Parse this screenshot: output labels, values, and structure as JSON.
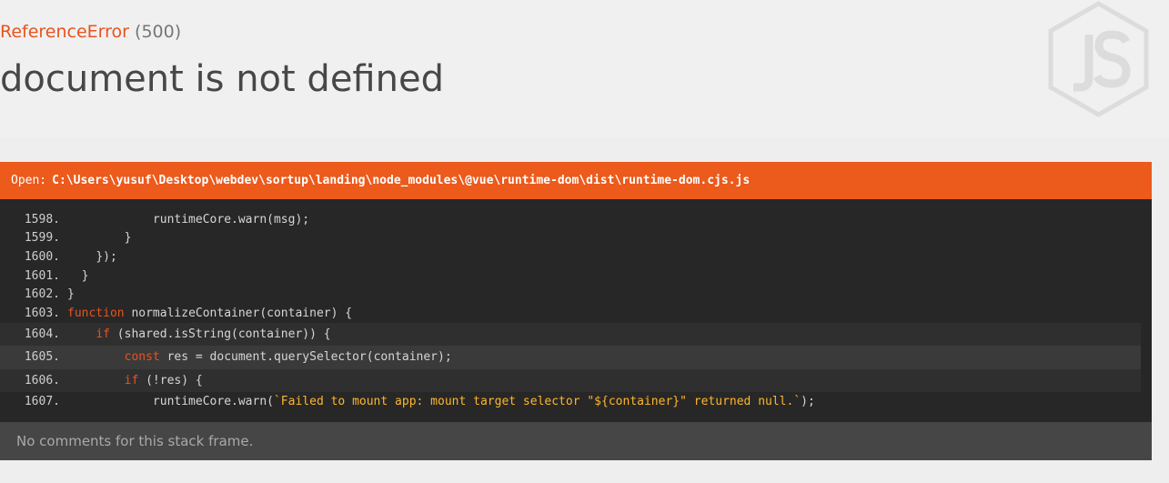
{
  "error": {
    "type": "ReferenceError",
    "status": "(500)",
    "message": "document is not defined"
  },
  "logo": {
    "icon": "nodejs-logo-icon"
  },
  "frame": {
    "open_label": "Open:",
    "file_path": "C:\\Users\\yusuf\\Desktop\\webdev\\sortup\\landing\\node_modules\\@vue\\runtime-dom\\dist\\runtime-dom.cjs.js",
    "lines": [
      {
        "num": "1598.",
        "indent": "            ",
        "parts": [
          {
            "t": "runtimeCore.warn(msg);",
            "c": ""
          }
        ]
      },
      {
        "num": "1599.",
        "indent": "        ",
        "parts": [
          {
            "t": "}",
            "c": ""
          }
        ]
      },
      {
        "num": "1600.",
        "indent": "    ",
        "parts": [
          {
            "t": "});",
            "c": ""
          }
        ]
      },
      {
        "num": "1601.",
        "indent": "  ",
        "parts": [
          {
            "t": "}",
            "c": ""
          }
        ]
      },
      {
        "num": "1602.",
        "indent": "",
        "parts": [
          {
            "t": "}",
            "c": ""
          }
        ]
      },
      {
        "num": "1603.",
        "indent": "",
        "parts": [
          {
            "t": "function",
            "c": "kw"
          },
          {
            "t": " normalizeContainer(container) {",
            "c": ""
          }
        ]
      },
      {
        "num": "1604.",
        "indent": "    ",
        "hl": "hl",
        "parts": [
          {
            "t": "if",
            "c": "kw"
          },
          {
            "t": " (shared.isString(container)) {",
            "c": ""
          }
        ]
      },
      {
        "num": "1605.",
        "indent": "        ",
        "hl": "hl2",
        "parts": [
          {
            "t": "const",
            "c": "kw"
          },
          {
            "t": " res = document.querySelector(container);",
            "c": ""
          }
        ]
      },
      {
        "num": "1606.",
        "indent": "        ",
        "hl": "hl",
        "parts": [
          {
            "t": "if",
            "c": "kw"
          },
          {
            "t": " (!res) {",
            "c": ""
          }
        ]
      },
      {
        "num": "1607.",
        "indent": "            ",
        "parts": [
          {
            "t": "runtimeCore.warn(",
            "c": ""
          },
          {
            "t": "`Failed to mount app: mount target selector \"${container}\" returned null.`",
            "c": "str"
          },
          {
            "t": ");",
            "c": ""
          }
        ]
      }
    ],
    "comments": "No comments for this stack frame."
  }
}
